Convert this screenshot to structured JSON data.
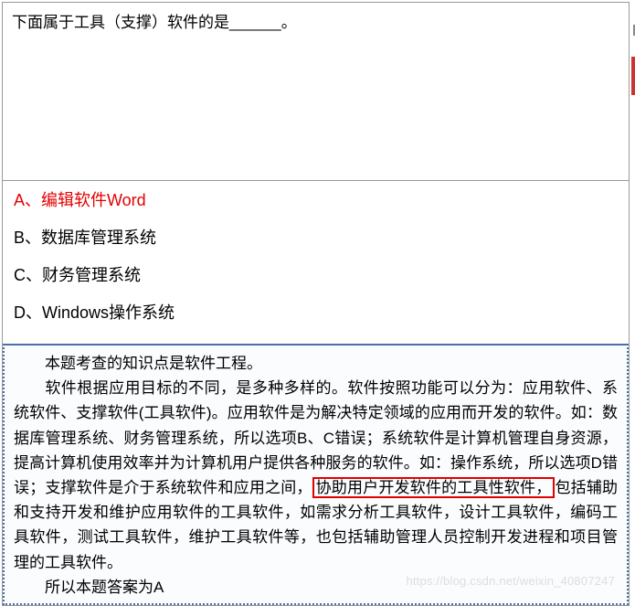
{
  "question": {
    "stem": "下面属于工具（支撑）软件的是______。"
  },
  "options": {
    "a": "A、编辑软件Word",
    "b": "B、数据库管理系统",
    "c": "C、财务管理系统",
    "d": "D、Windows操作系统"
  },
  "explanation": {
    "line1": "本题考查的知识点是软件工程。",
    "pre_box": "软件根据应用目标的不同，是多种多样的。软件按照功能可以分为：应用软件、系统软件、支撑软件(工具软件)。应用软件是为解决特定领域的应用而开发的软件。如：数据库管理系统、财务管理系统，所以选项B、C错误；系统软件是计算机管理自身资源，提高计算机使用效率并为计算机用户提供各种服务的软件。如：操作系统，所以选项D错误；支撑软件是介于系统软件和应用之间，",
    "boxed": "协助用户开发软件的工具性软件，",
    "post_box": "包括辅助和支持开发和维护应用软件的工具软件，如需求分析工具软件，设计工具软件，编码工具软件，测试工具软件，维护工具软件等，也包括辅助管理人员控制开发进程和项目管理的工具软件。",
    "answer": "所以本题答案为A"
  },
  "watermark": "https://blog.csdn.net/weixin_40807247"
}
